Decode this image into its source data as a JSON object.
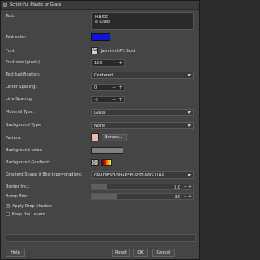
{
  "window": {
    "title": "Script-Fu: Plastic or Glass"
  },
  "fields": {
    "text": {
      "label": "Text:",
      "value": "Plastic\n& Glass"
    },
    "text_color": {
      "label": "Text color:",
      "color": "#1414d8"
    },
    "font": {
      "label": "Font:",
      "value": "JasmineUPC Bold",
      "icon_text": "Aa"
    },
    "font_size": {
      "label": "Font size (pixels):",
      "value": "150"
    },
    "text_justification": {
      "label": "Text Justification:",
      "value": "Centered"
    },
    "letter_spacing": {
      "label": "Letter Spacing:",
      "value": "0"
    },
    "line_spacing": {
      "label": "Line Spacing:",
      "value": "-5"
    },
    "material_type": {
      "label": "Material Type:",
      "value": "Glass"
    },
    "background_type": {
      "label": "Background Type:",
      "value": "None"
    },
    "pattern": {
      "label": "Pattern:",
      "browse_label": "Browse..."
    },
    "background_color": {
      "label": "Background color:",
      "color": "#808080"
    },
    "background_gradient": {
      "label": "Background Gradient:"
    },
    "gradient_shape": {
      "label": "Gradient Shape if Bkg-type=gradient:",
      "value": "GRADIENT-SHAPEBURST-ANGULAR"
    },
    "border_inc": {
      "label": "Border Inc.:",
      "value": "3.0",
      "level": 0.15
    },
    "bump_blur": {
      "label": "Bump Blur:",
      "value": "30",
      "level": 0.25
    },
    "apply_drop_shadow": {
      "label": "Apply Drop Shadow",
      "checked": true
    },
    "keep_layers": {
      "label": "Keep the Layers",
      "checked": false
    }
  },
  "buttons": {
    "help": "Help",
    "reset": "Reset",
    "ok": "OK",
    "cancel": "Cancel"
  },
  "icons": {
    "minus": "−",
    "plus": "+",
    "check": "✕"
  }
}
